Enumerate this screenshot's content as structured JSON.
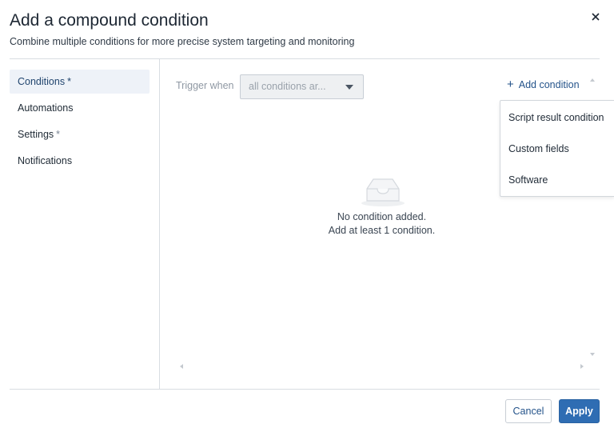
{
  "dialog": {
    "title": "Add a compound condition",
    "subtitle": "Combine multiple conditions for more precise system targeting and monitoring",
    "close_icon": "close-icon"
  },
  "sidebar": {
    "items": [
      {
        "label": "Conditions",
        "required_mark": "*",
        "active": true
      },
      {
        "label": "Automations",
        "required_mark": "",
        "active": false
      },
      {
        "label": "Settings",
        "required_mark": "*",
        "active": false
      },
      {
        "label": "Notifications",
        "required_mark": "",
        "active": false
      }
    ]
  },
  "conditions": {
    "trigger_label": "Trigger when",
    "trigger_value": "all conditions ar...",
    "add_condition_label": "Add condition",
    "add_condition_icon": "plus-icon",
    "menu_items": [
      "Script result condition",
      "Custom fields",
      "Software"
    ],
    "empty_icon": "empty-inbox-icon",
    "empty_line1": "No condition added.",
    "empty_line2": "Add at least 1 condition."
  },
  "footer": {
    "cancel_label": "Cancel",
    "apply_label": "Apply"
  },
  "colors": {
    "accent": "#2f6db3",
    "link": "#24538a",
    "active_nav_bg": "#eef2f8"
  }
}
